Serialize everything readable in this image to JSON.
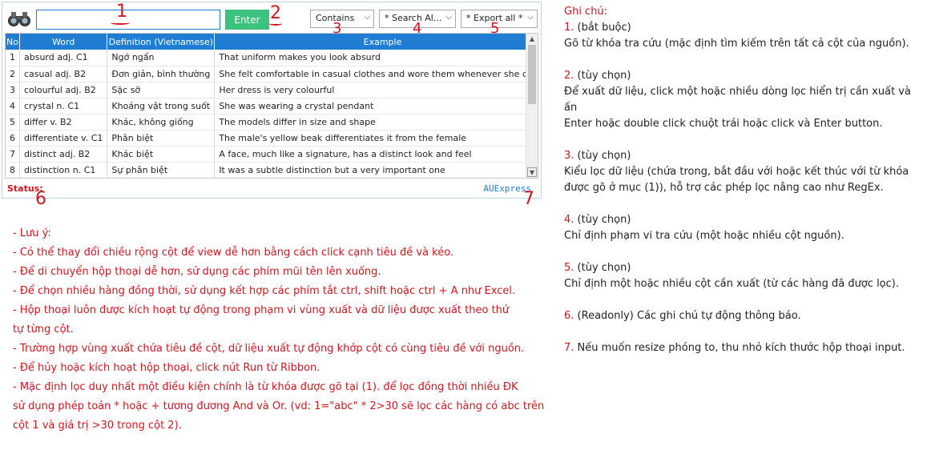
{
  "toolbar": {
    "search_value": "",
    "enter_label": "Enter",
    "filter_type": "Contains",
    "search_scope": "* Search Al...",
    "export_scope": "* Export all *"
  },
  "grid": {
    "columns": [
      "No",
      "Word",
      "Definition (Vietnamese)",
      "Example"
    ],
    "rows": [
      [
        "1",
        "absurd adj. C1",
        "Ngớ ngẩn",
        "That uniform makes you look absurd"
      ],
      [
        "2",
        "casual adj. B2",
        "Đơn giản, bình thường",
        "She felt comfortable in casual clothes and wore them whenever she could"
      ],
      [
        "3",
        "colourful adj. B2",
        "Sặc sỡ",
        "Her dress is very colourful"
      ],
      [
        "4",
        "crystal n. C1",
        "Khoáng vật trong suốt",
        "She was wearing a crystal pendant"
      ],
      [
        "5",
        "differ v. B2",
        "Khác, không giống",
        "The models differ in size and shape"
      ],
      [
        "6",
        "differentiate v. C1",
        "Phân biệt",
        "The male's yellow beak differentiates it from the female"
      ],
      [
        "7",
        "distinct adj. B2",
        "Khác biệt",
        "A face, much like a signature, has a distinct look and feel"
      ],
      [
        "8",
        "distinction n. C1",
        "Sự phân biệt",
        "It was a subtle distinction but a very important one"
      ]
    ]
  },
  "status": {
    "label": "Status:",
    "brand": "AUExpress"
  },
  "callouts": [
    "1",
    "2",
    "3",
    "4",
    "5",
    "6",
    "7"
  ],
  "notes_left": [
    "- Lưu ý:",
    "- Có thể thay đổi chiều rộng cột để view dễ hơn bằng cách click cạnh tiêu đề và kéo.",
    "- Để di chuyển hộp thoại dễ hơn, sử dụng các phím mũi tên lên xuống.",
    "- Để chọn nhiều hàng đồng thời, sử dụng kết hợp các phím tắt ctrl, shift hoặc ctrl + A như Excel.",
    "- Hộp thoại luôn được kích hoạt tự động trong phạm vi vùng xuất và dữ liệu được xuất theo thứ",
    "tự từng cột.",
    "- Trường hợp vùng xuất chứa tiêu đề cột, dữ liệu xuất tự động khớp cột có cùng tiêu đề với nguồn.",
    "- Để hủy hoặc kích hoạt hộp thoại, click nút Run từ Ribbon.",
    "- Mặc định lọc duy nhất một điều kiện chính là từ khóa được gõ tại (1). để lọc đồng thời nhiều ĐK",
    "sử dụng phép toán * hoặc + tương đương And và Or. (vd: 1=\"abc\" * 2>30 sẽ lọc các hàng có abc trên",
    "cột 1 và giá trị >30 trong cột 2)."
  ],
  "notes_right": {
    "title": "Ghi chú:",
    "items": [
      {
        "num": "1.",
        "head": "(bắt buộc)",
        "body": [
          "Gõ từ khóa tra cứu (mặc định tìm kiếm trên tất cả cột của nguồn)."
        ]
      },
      {
        "num": "2.",
        "head": "(tùy chọn)",
        "body": [
          "Để xuất dữ liệu, click một hoặc nhiều dòng lọc hiển trị cần xuất và ấn",
          "Enter hoặc double click chuột trái hoặc click và Enter button."
        ]
      },
      {
        "num": "3.",
        "head": "(tùy chọn)",
        "body": [
          "Kiểu lọc dữ liệu (chứa trong, bắt đầu với hoặc kết thúc với từ khóa",
          "được gõ ở mục (1)), hỗ trợ các phép lọc nâng cao như RegEx."
        ]
      },
      {
        "num": "4.",
        "head": "(tùy chọn)",
        "body": [
          "Chỉ định phạm vi tra cứu (một hoặc nhiều cột nguồn)."
        ]
      },
      {
        "num": "5.",
        "head": "(tùy chọn)",
        "body": [
          "Chỉ định một hoặc nhiều cột cần xuất (từ các hàng đã được lọc)."
        ]
      },
      {
        "num": "6.",
        "head": "(Readonly) Các ghi chú tự động thông báo.",
        "body": []
      },
      {
        "num": "7.",
        "head": "Nếu muốn resize phóng to, thu nhỏ kích thước hộp thoại input.",
        "body": []
      }
    ]
  },
  "colors": {
    "accent": "#1f7ed1",
    "enter": "#3cc27e",
    "callout": "#d0161e"
  }
}
